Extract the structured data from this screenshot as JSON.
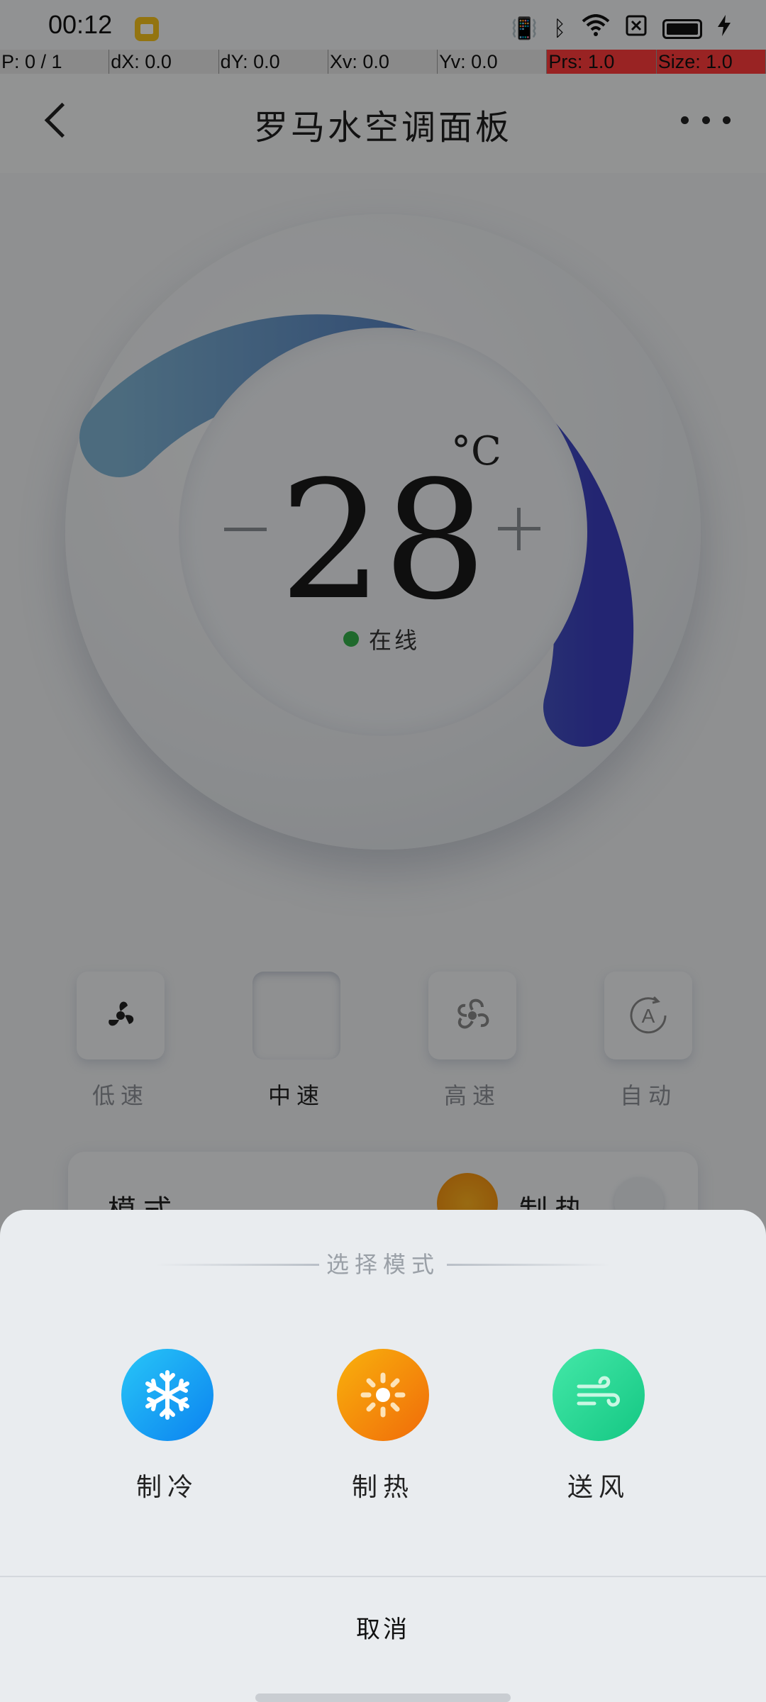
{
  "status_bar": {
    "time": "00:12",
    "icons": [
      "notification-app-icon",
      "mute-vibrate-icon",
      "bluetooth-icon",
      "wifi-icon",
      "sim-off-icon",
      "battery-icon",
      "charging-icon"
    ]
  },
  "debug_bar": {
    "pointer": "P: 0 / 1",
    "dx": "dX: 0.0",
    "dy": "dY: 0.0",
    "xv": "Xv: 0.0",
    "yv": "Yv: 0.0",
    "prs": "Prs: 1.0",
    "size": "Size: 1.0"
  },
  "header": {
    "title": "罗马水空调面板"
  },
  "thermostat": {
    "temperature": "28",
    "unit": "°C",
    "minus_label": "−",
    "plus_label": "+",
    "status": "在线",
    "status_color": "#35b04a"
  },
  "speeds": [
    {
      "label": "低速",
      "icon": "fan-low-icon",
      "active": false
    },
    {
      "label": "中速",
      "icon": "fan-mid-icon",
      "active": true
    },
    {
      "label": "高速",
      "icon": "fan-high-icon",
      "active": false
    },
    {
      "label": "自动",
      "icon": "auto-icon",
      "active": false
    }
  ],
  "mode_card": {
    "label": "模式",
    "value": "制热"
  },
  "sheet": {
    "title": "选择模式",
    "options": [
      {
        "label": "制冷",
        "icon": "snowflake-icon",
        "color": "#0b82f0"
      },
      {
        "label": "制热",
        "icon": "sun-icon",
        "color": "#f06b0a"
      },
      {
        "label": "送风",
        "icon": "wind-icon",
        "color": "#14c783"
      }
    ],
    "cancel": "取消"
  }
}
